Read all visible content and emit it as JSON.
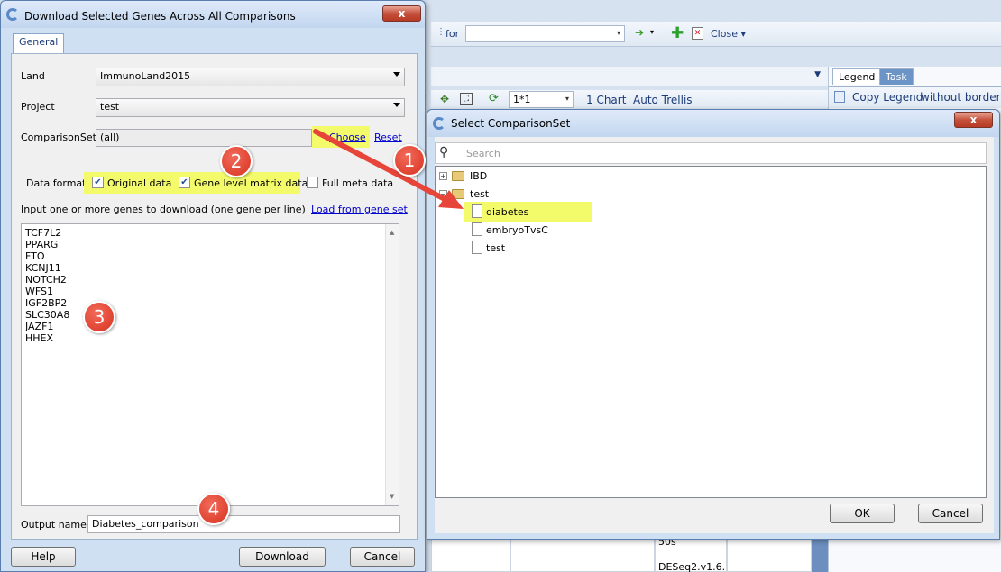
{
  "background_app": {
    "search_for_label": "for",
    "close_label": "Close",
    "chart_layout_value": "1*1",
    "chart_count_label": "1 Chart",
    "auto_trellis_label": "Auto Trellis",
    "legend_tab": "Legend",
    "task_tab": "Task",
    "copy_legend_label": "Copy Legend",
    "without_border_label": "without border",
    "grid_cell_1": "50s",
    "grid_cell_2": "DESeq2.v1.6."
  },
  "download_dialog": {
    "title": "Download Selected Genes Across All Comparisons",
    "close_symbol": "x",
    "tab_general": "General",
    "land_label": "Land",
    "land_value": "ImmunoLand2015",
    "project_label": "Project",
    "project_value": "test",
    "comparisonset_label": "ComparisonSet",
    "comparisonset_value": "(all)",
    "choose_link": "Choose",
    "reset_link": "Reset",
    "data_format_label": "Data format",
    "original_data_label": "Original data",
    "original_data_checked": true,
    "gene_level_label": "Gene level matrix data",
    "gene_level_checked": true,
    "full_meta_label": "Full meta data",
    "full_meta_checked": false,
    "genes_instruction": "Input one or more genes to download (one gene per line)",
    "load_gene_set_link": "Load from gene set",
    "genes": [
      "TCF7L2",
      "PPARG",
      "FTO",
      "KCNJ11",
      "NOTCH2",
      "WFS1",
      "IGF2BP2",
      "SLC30A8",
      "JAZF1",
      "HHEX"
    ],
    "output_name_label": "Output name",
    "output_name_value": "Diabetes_comparison",
    "help_button": "Help",
    "download_button": "Download",
    "cancel_button": "Cancel"
  },
  "select_dialog": {
    "title": "Select ComparisonSet",
    "close_symbol": "x",
    "search_placeholder": "Search",
    "tree": {
      "folder_ibd": "IBD",
      "folder_test": "test",
      "items": [
        "diabetes",
        "embryoTvsC",
        "test"
      ]
    },
    "ok_button": "OK",
    "cancel_button": "Cancel"
  },
  "annotations": {
    "badge_1": "1",
    "badge_2": "2",
    "badge_3": "3",
    "badge_4": "4"
  },
  "colors": {
    "highlight": "#f4fb6a",
    "badge": "#d8321f",
    "arrow": "#e8453a",
    "link": "#0000cc"
  }
}
